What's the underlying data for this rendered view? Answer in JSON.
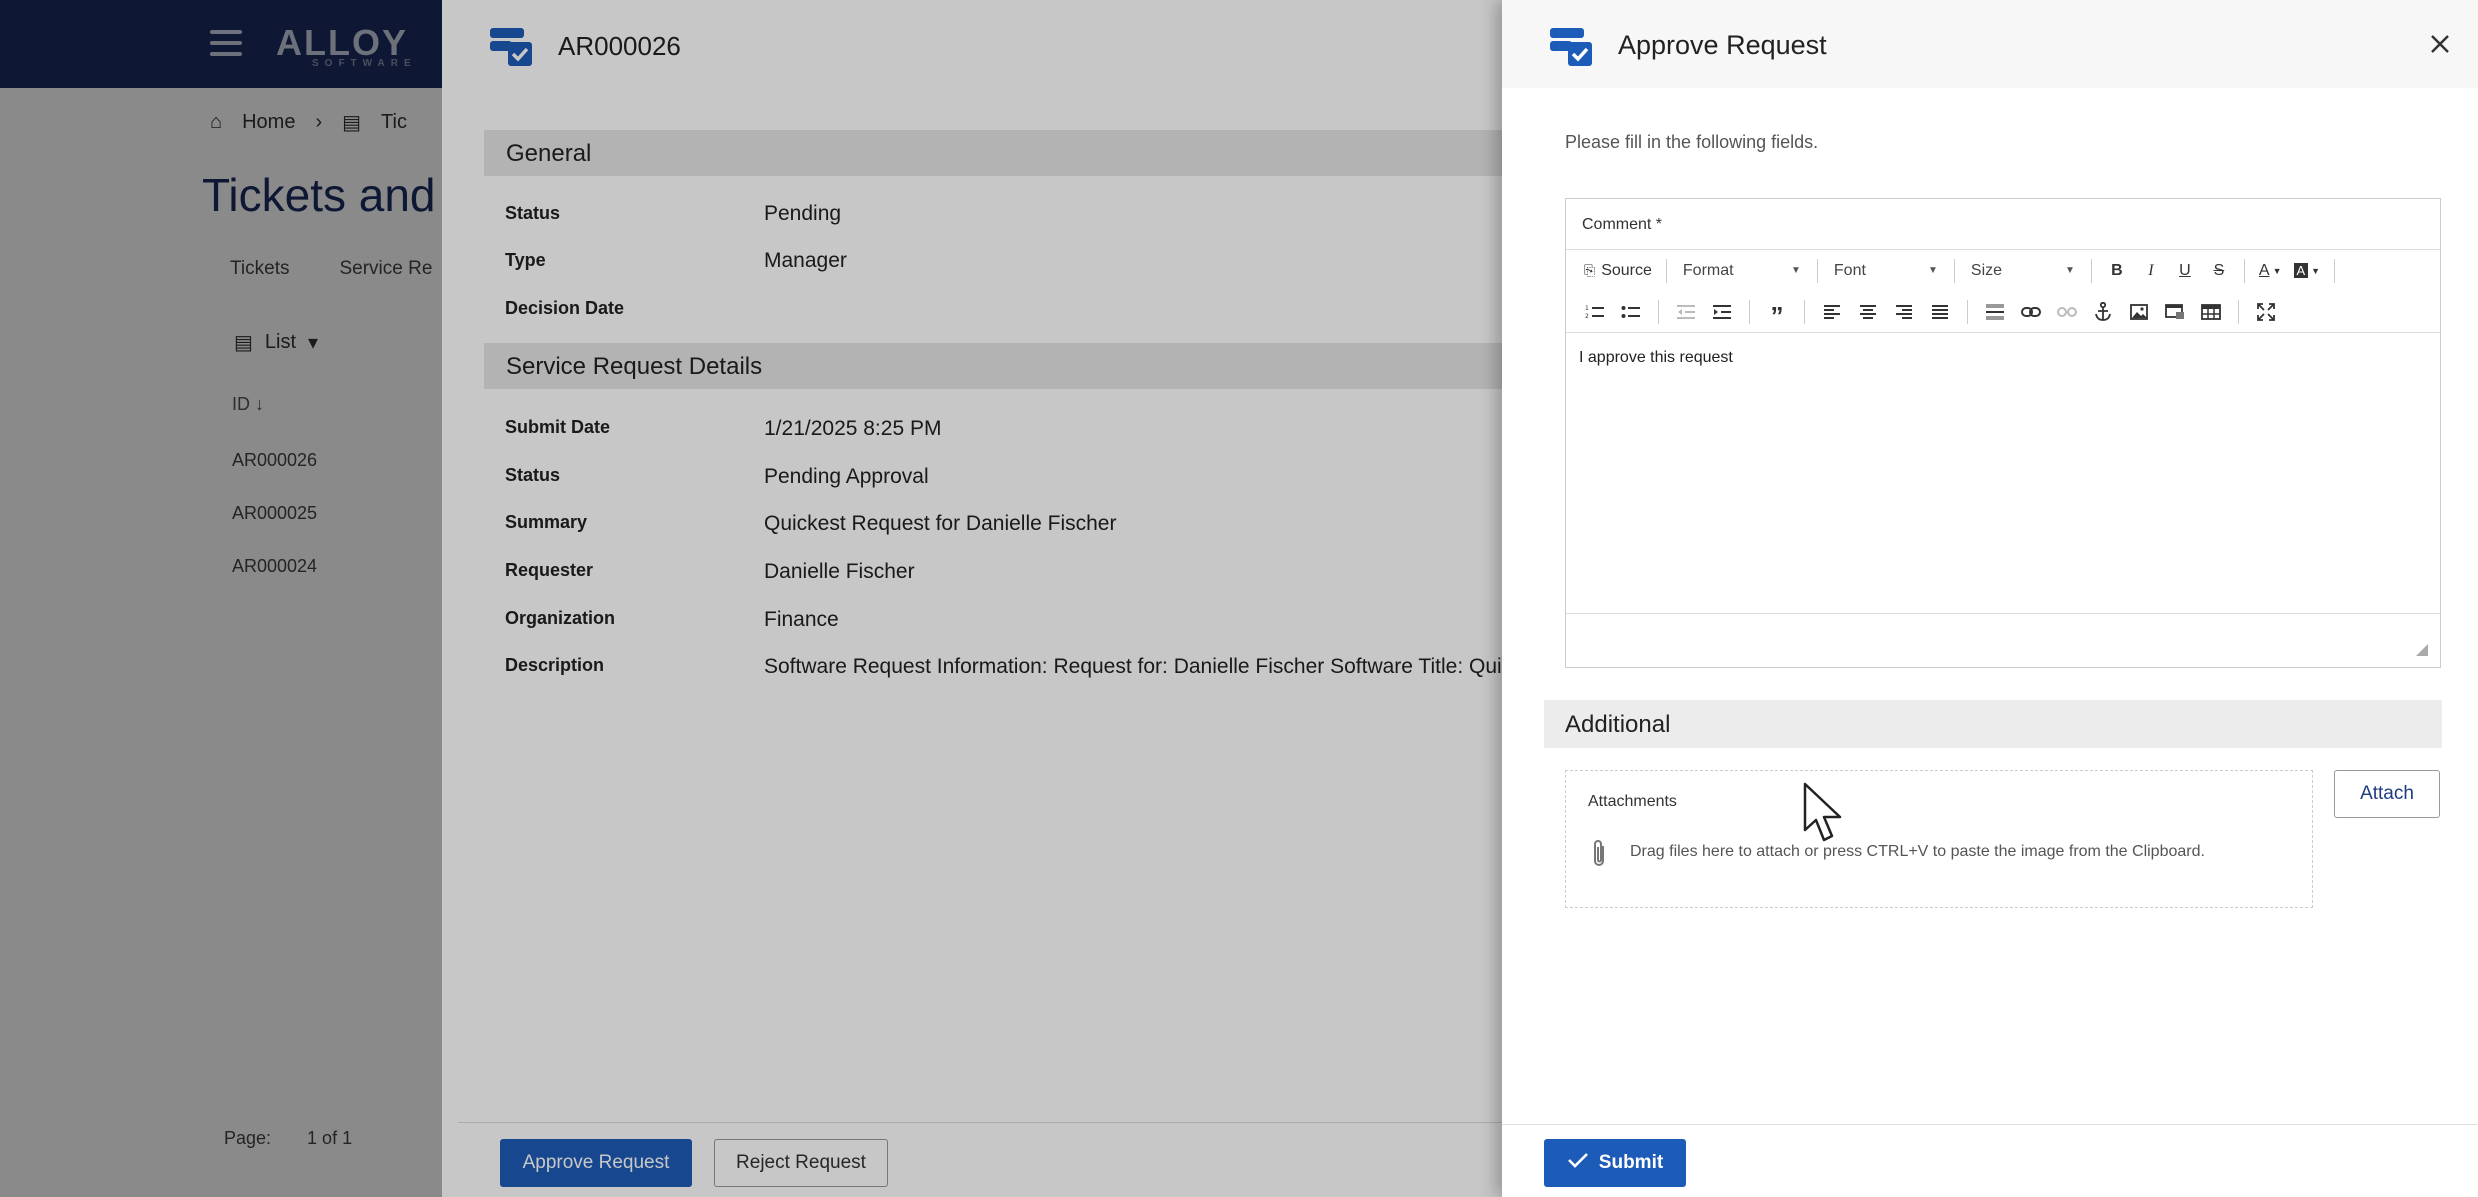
{
  "base_app": {
    "logo_text": "ALLOY",
    "logo_sub": "SOFTWARE",
    "breadcrumb_home": "Home",
    "breadcrumb_next": "Tic",
    "page_title": "Tickets and",
    "tabs": [
      "Tickets",
      "Service Re"
    ],
    "view_label": "List",
    "id_column": "ID ↓",
    "rows": [
      "AR000026",
      "AR000025",
      "AR000024"
    ],
    "pager_label": "Page:",
    "pager_value": "1 of 1"
  },
  "mid_panel": {
    "title": "AR000026",
    "general": {
      "heading": "General",
      "fields": [
        {
          "label": "Status",
          "value": "Pending"
        },
        {
          "label": "Type",
          "value": "Manager"
        },
        {
          "label": "Decision Date",
          "value": ""
        }
      ]
    },
    "details": {
      "heading": "Service Request Details",
      "fields": [
        {
          "label": "Submit Date",
          "value": "1/21/2025 8:25 PM"
        },
        {
          "label": "Status",
          "value": "Pending Approval"
        },
        {
          "label": "Summary",
          "value": "Quickest Request for Danielle Fischer"
        },
        {
          "label": "Requester",
          "value": "Danielle Fischer"
        },
        {
          "label": "Organization",
          "value": "Finance"
        },
        {
          "label": "Description",
          "value": "Software Request Information: Request for: Danielle Fischer Software Title: Qui"
        }
      ]
    },
    "approve_label": "Approve Request",
    "reject_label": "Reject Request"
  },
  "drawer": {
    "title": "Approve Request",
    "instructions": "Please fill in the following fields.",
    "editor": {
      "label": "Comment *",
      "source_label": "Source",
      "format_label": "Format",
      "font_label": "Font",
      "size_label": "Size",
      "content": "I approve this request"
    },
    "additional_heading": "Additional",
    "attachments_label": "Attachments",
    "attachments_hint": "Drag files here to attach or press CTRL+V to paste the image from the Clipboard.",
    "attach_label": "Attach",
    "submit_label": "Submit"
  },
  "colors": {
    "navy": "#1b2c5e",
    "primary": "#1d5bb8"
  }
}
